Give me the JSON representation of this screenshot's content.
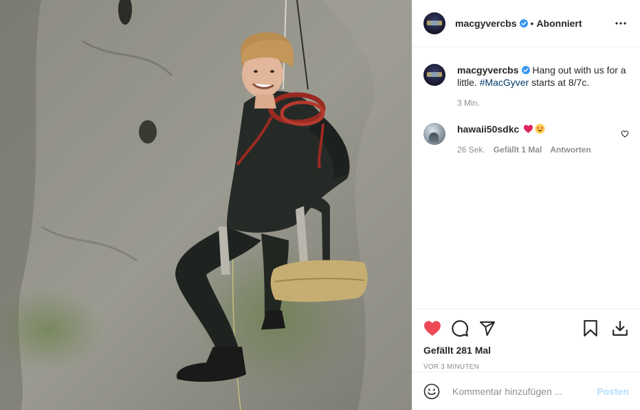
{
  "post": {
    "photo_description_icon": "climber-photo",
    "author": {
      "username": "macgyvercbs",
      "verified": true,
      "separator": "•",
      "follow_state": "Abonniert",
      "more_icon": "more-icon"
    },
    "caption": {
      "username": "macgyvercbs",
      "text_before": "Hang out with us for a little.",
      "hashtag": "#MacGyver",
      "text_after": "starts at 8/7c.",
      "time": "3 Min."
    },
    "comments": [
      {
        "username": "hawaii50sdkc",
        "text": "",
        "emojis": [
          "red-heart-emoji",
          "star-struck-emoji"
        ],
        "time": "26 Sek.",
        "likes": "Gefällt 1 Mal",
        "reply": "Antworten"
      }
    ],
    "actions": {
      "like_icon": "heart-filled-icon",
      "comment_icon": "comment-icon",
      "share_icon": "share-icon",
      "save_icon": "bookmark-icon",
      "download_icon": "download-icon"
    },
    "likes_text": "Gefällt 281 Mal",
    "time_ago": "VOR 3 MINUTEN",
    "add_comment": {
      "placeholder": "Kommentar hinzufügen ...",
      "post_label": "Posten",
      "emoji_icon": "emoji-icon"
    },
    "colors": {
      "like_red": "#ed4956",
      "verified_blue": "#3897f0",
      "hashtag": "#00376b",
      "muted": "#8e8e8e",
      "post_disabled": "#b2dffc"
    }
  }
}
